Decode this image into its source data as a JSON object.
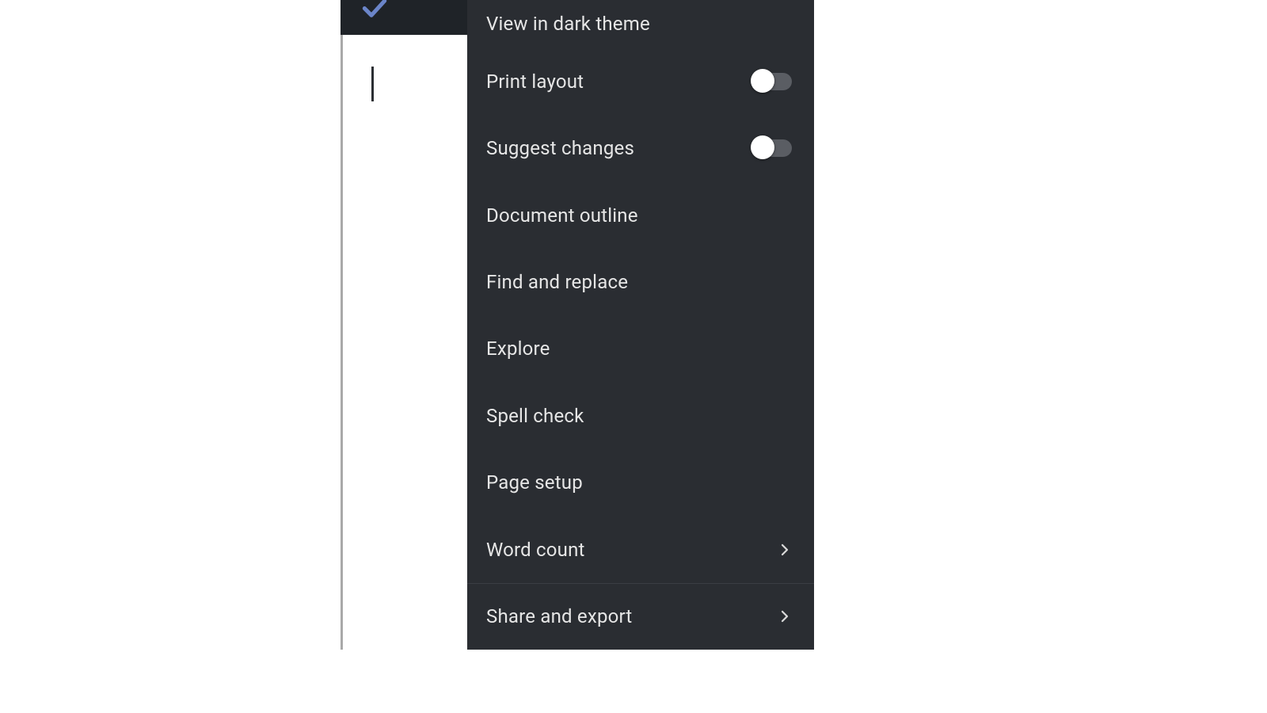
{
  "menu": {
    "items": [
      {
        "label": "View in dark theme",
        "has_toggle": false,
        "has_chevron": false
      },
      {
        "label": "Print layout",
        "has_toggle": true,
        "has_chevron": false
      },
      {
        "label": "Suggest changes",
        "has_toggle": true,
        "has_chevron": false
      },
      {
        "label": "Document outline",
        "has_toggle": false,
        "has_chevron": false
      },
      {
        "label": "Find and replace",
        "has_toggle": false,
        "has_chevron": false
      },
      {
        "label": "Explore",
        "has_toggle": false,
        "has_chevron": false
      },
      {
        "label": "Spell check",
        "has_toggle": false,
        "has_chevron": false
      },
      {
        "label": "Page setup",
        "has_toggle": false,
        "has_chevron": false
      },
      {
        "label": "Word count",
        "has_toggle": false,
        "has_chevron": true
      },
      {
        "label": "Share and export",
        "has_toggle": false,
        "has_chevron": true
      }
    ]
  }
}
